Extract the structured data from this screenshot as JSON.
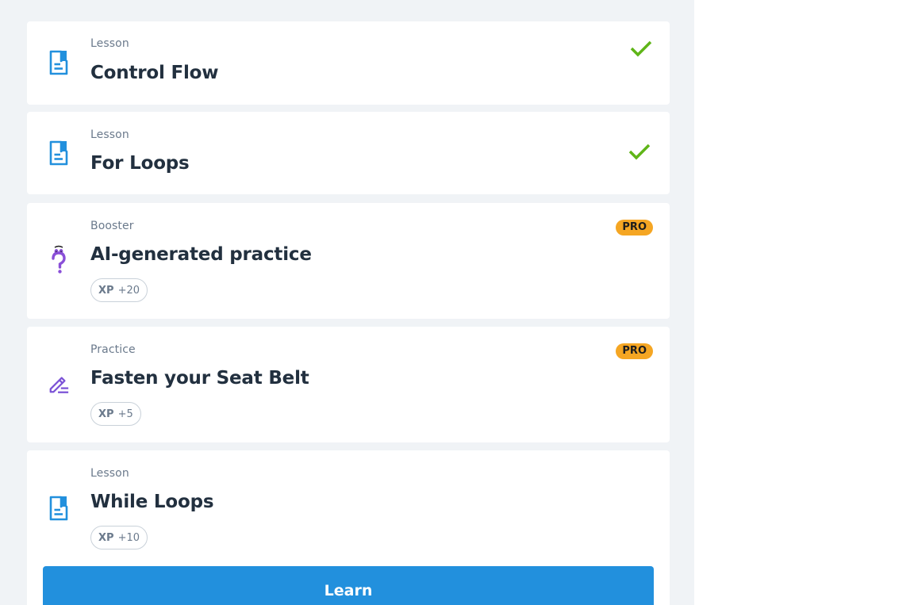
{
  "colors": {
    "accent": "#2290dd",
    "check": "#5fb518",
    "pro_badge": "#f5a623",
    "booster_icon": "#8a4fd8",
    "practice_icon": "#7b52d6"
  },
  "items": [
    {
      "kind": "Lesson",
      "title": "Control Flow",
      "icon": "lesson-doc-icon",
      "status": "completed"
    },
    {
      "kind": "Lesson",
      "title": "For Loops",
      "icon": "lesson-doc-icon",
      "status": "completed"
    },
    {
      "kind": "Booster",
      "title": "AI-generated practice",
      "icon": "question-mark-icon",
      "badge": "PRO",
      "xp_label": "XP",
      "xp_value": "+20"
    },
    {
      "kind": "Practice",
      "title": "Fasten your Seat Belt",
      "icon": "pencil-edit-icon",
      "badge": "PRO",
      "xp_label": "XP",
      "xp_value": "+5"
    },
    {
      "kind": "Lesson",
      "title": "While Loops",
      "icon": "lesson-doc-icon",
      "xp_label": "XP",
      "xp_value": "+10",
      "action_label": "Learn"
    }
  ]
}
